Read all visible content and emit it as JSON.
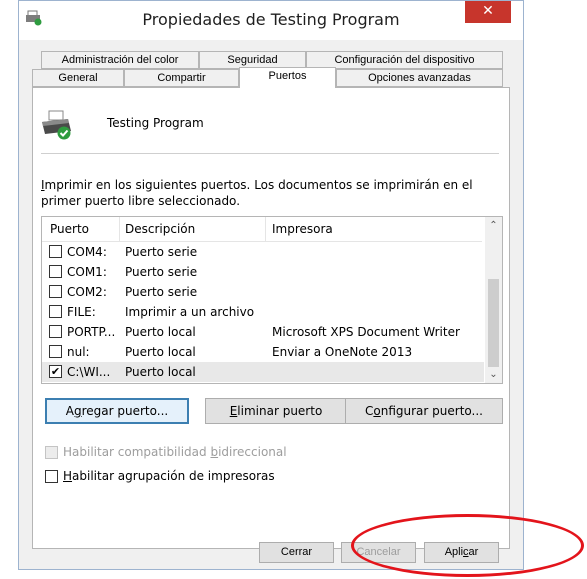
{
  "window": {
    "title": "Propiedades de Testing Program",
    "close_label": "✕"
  },
  "tabs": {
    "row1": [
      "Administración del color",
      "Seguridad",
      "Configuración del dispositivo"
    ],
    "row2": [
      "General",
      "Compartir",
      "Puertos",
      "Opciones avanzadas"
    ],
    "active": "Puertos"
  },
  "printer": {
    "name": "Testing Program"
  },
  "instructions": {
    "first_char": "I",
    "line1_rest": "mprimir en los siguientes puertos. Los documentos se imprimirán en el",
    "line2": "primer puerto libre seleccionado."
  },
  "ports_table": {
    "columns": [
      "Puerto",
      "Descripción",
      "Impresora"
    ],
    "rows": [
      {
        "checked": false,
        "port": "COM4:",
        "description": "Puerto serie",
        "printer": ""
      },
      {
        "checked": false,
        "port": "COM1:",
        "description": "Puerto serie",
        "printer": ""
      },
      {
        "checked": false,
        "port": "COM2:",
        "description": "Puerto serie",
        "printer": ""
      },
      {
        "checked": false,
        "port": "FILE:",
        "description": "Imprimir a un archivo",
        "printer": ""
      },
      {
        "checked": false,
        "port": "PORTP...",
        "description": "Puerto local",
        "printer": "Microsoft XPS Document Writer"
      },
      {
        "checked": false,
        "port": "nul:",
        "description": "Puerto local",
        "printer": "Enviar a OneNote 2013"
      },
      {
        "checked": true,
        "port": "C:\\WI...",
        "description": "Puerto local",
        "printer": ""
      }
    ],
    "checkmark": "✔",
    "scroll_up": "⌃",
    "scroll_down": "⌄"
  },
  "port_buttons": {
    "add": {
      "pre": "A",
      "key": "g",
      "post": "regar puerto..."
    },
    "delete": {
      "pre": "",
      "key": "E",
      "post": "liminar puerto"
    },
    "configure": {
      "pre": "C",
      "key": "o",
      "post": "nfigurar puerto..."
    }
  },
  "options": {
    "bidirectional": {
      "pre": "Habilitar compatibilidad ",
      "key": "b",
      "post": "idireccional",
      "enabled": false,
      "checked": false
    },
    "pooling": {
      "pre": "",
      "key": "H",
      "post": "abilitar agrupación de impresoras",
      "enabled": true,
      "checked": false
    }
  },
  "footer": {
    "close": "Cerrar",
    "cancel": "Cancelar",
    "apply_pre": "Apli",
    "apply_key": "c",
    "apply_post": "ar"
  },
  "colors": {
    "close_button": "#c7352c",
    "annotation": "#e3141b",
    "default_button_border": "#3c7fb1"
  }
}
